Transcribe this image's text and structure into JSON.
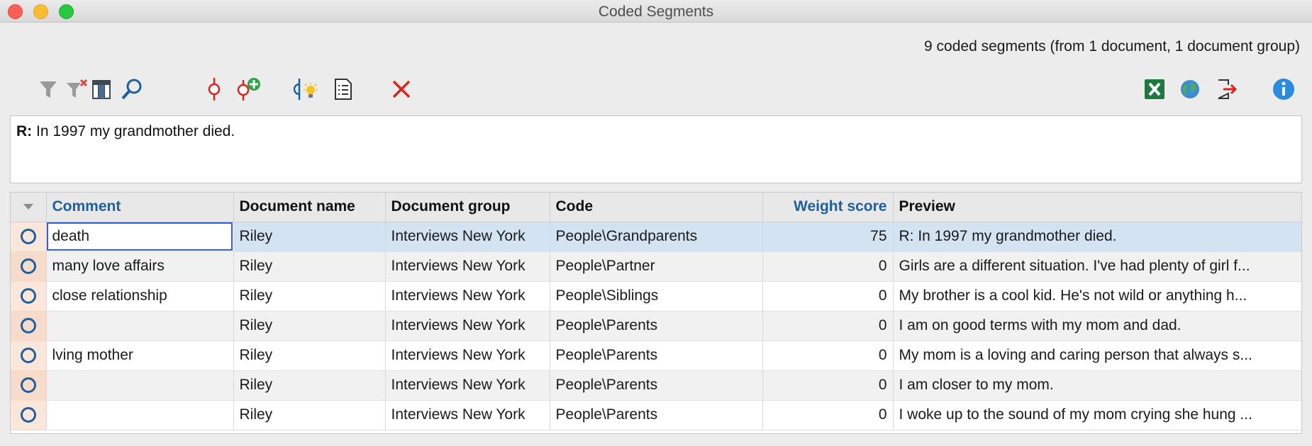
{
  "window": {
    "title": "Coded Segments"
  },
  "summary": "9 coded segments (from 1 document, 1 document group)",
  "toolbar": {
    "left_icons": [
      "filter-icon",
      "clear-filter-icon",
      "columns-icon",
      "search-icon",
      "code-icon",
      "add-code-icon",
      "smart-code-icon",
      "overview-icon",
      "delete-icon"
    ],
    "right_icons": [
      "excel-export-icon",
      "web-export-icon",
      "export-icon",
      "info-icon"
    ]
  },
  "preview": {
    "speaker": "R:",
    "text": "In 1997 my grandmother died."
  },
  "table": {
    "columns": [
      "Comment",
      "Document name",
      "Document group",
      "Code",
      "Weight score",
      "Preview"
    ],
    "rows": [
      {
        "comment": "death",
        "document": "Riley",
        "group": "Interviews New York",
        "code": "People\\Grandparents",
        "weight": "75",
        "preview": "R: In 1997 my grandmother died."
      },
      {
        "comment": "many love affairs",
        "document": "Riley",
        "group": "Interviews New York",
        "code": "People\\Partner",
        "weight": "0",
        "preview": "Girls are a different situation. I've had plenty of girl f..."
      },
      {
        "comment": "close relationship",
        "document": "Riley",
        "group": "Interviews New York",
        "code": "People\\Siblings",
        "weight": "0",
        "preview": "My brother is a cool kid. He's not wild or anything h..."
      },
      {
        "comment": "",
        "document": "Riley",
        "group": "Interviews New York",
        "code": "People\\Parents",
        "weight": "0",
        "preview": "I am on good terms with my mom and dad."
      },
      {
        "comment": "lving mother",
        "document": "Riley",
        "group": "Interviews New York",
        "code": "People\\Parents",
        "weight": "0",
        "preview": "My mom is a loving and caring person that always s..."
      },
      {
        "comment": "",
        "document": "Riley",
        "group": "Interviews New York",
        "code": "People\\Parents",
        "weight": "0",
        "preview": "I am closer to my mom."
      },
      {
        "comment": "",
        "document": "Riley",
        "group": "Interviews New York",
        "code": "People\\Parents",
        "weight": "0",
        "preview": "I woke up to the sound of my mom crying she hung ..."
      }
    ]
  },
  "colors": {
    "accent_blue": "#1f5f9e",
    "selected_row": "#d4e3f2",
    "marker_bg": "#fbe6da",
    "delete_red": "#d9261c",
    "excel_green": "#1d7a3e"
  }
}
